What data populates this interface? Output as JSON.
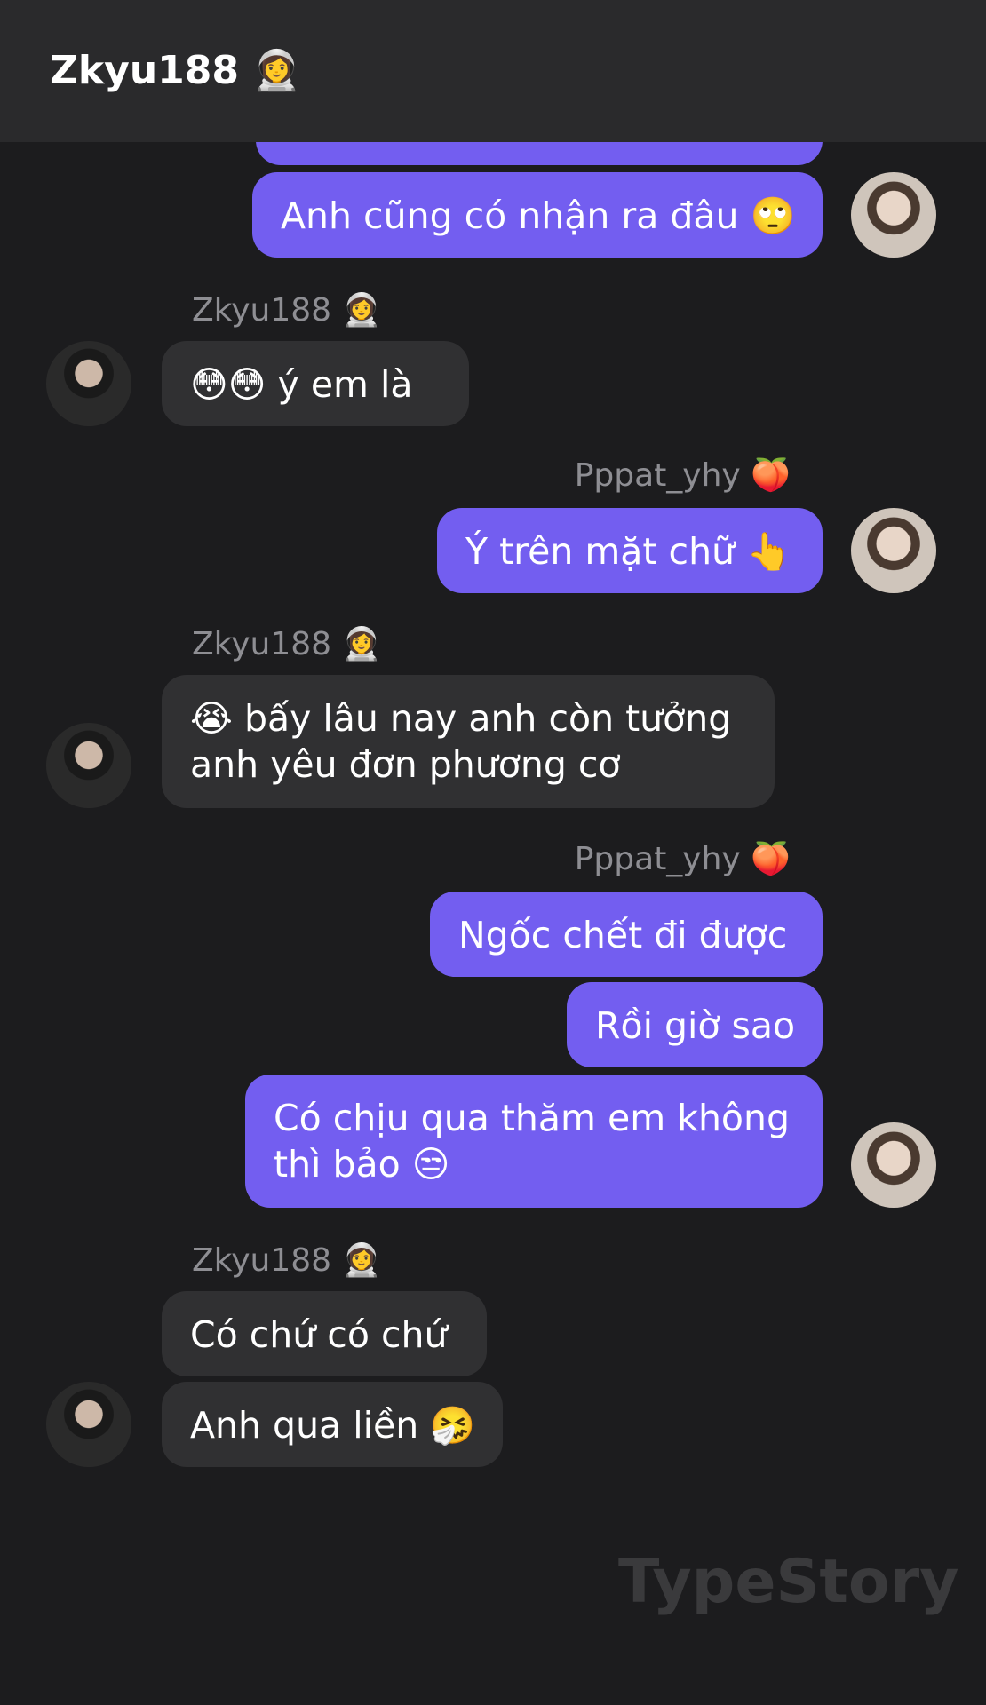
{
  "header": {
    "title": "Zkyu188 👩‍🚀"
  },
  "messages": [
    {
      "id": "m0",
      "text": ""
    },
    {
      "id": "m1",
      "text": "Anh cũng có nhận ra đâu 🙄"
    },
    {
      "id": "m2_sender",
      "text": "Zkyu188 👩‍🚀"
    },
    {
      "id": "m2",
      "text": "😳😳 ý em là"
    },
    {
      "id": "m3_sender",
      "text": "Pppat_yhy 🍑"
    },
    {
      "id": "m3",
      "text": "Ý trên mặt chữ 👆"
    },
    {
      "id": "m4_sender",
      "text": "Zkyu188 👩‍🚀"
    },
    {
      "id": "m4",
      "text": "😭 bấy lâu nay anh còn tưởng anh yêu đơn phương cơ"
    },
    {
      "id": "m5_sender",
      "text": "Pppat_yhy 🍑"
    },
    {
      "id": "m5",
      "text": "Ngốc chết đi được"
    },
    {
      "id": "m6",
      "text": "Rồi giờ sao"
    },
    {
      "id": "m7",
      "text": "Có chịu qua thăm em không thì bảo 😒"
    },
    {
      "id": "m8_sender",
      "text": "Zkyu188 👩‍🚀"
    },
    {
      "id": "m8",
      "text": "Có chứ có chứ"
    },
    {
      "id": "m9",
      "text": "Anh qua liền 🤧"
    }
  ],
  "watermark": "TypeStory",
  "colors": {
    "outgoing": "#735ef0",
    "incoming": "#303032",
    "background": "#1c1c1e",
    "header": "#2a2a2c"
  }
}
